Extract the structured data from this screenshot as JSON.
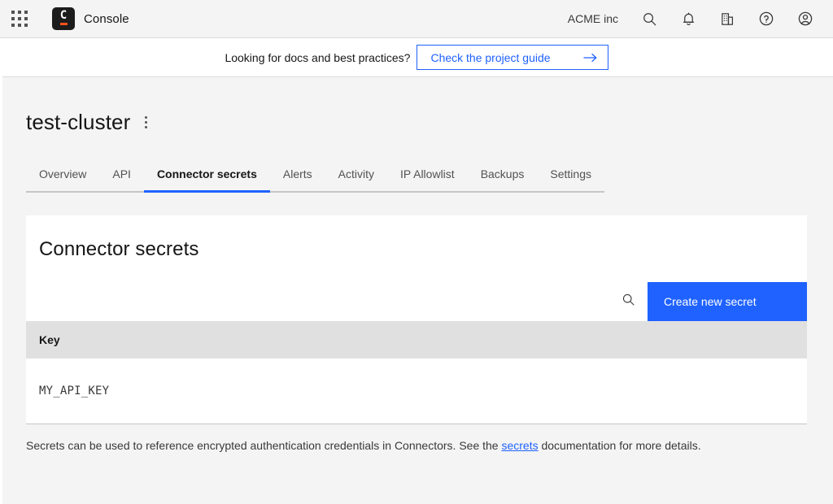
{
  "header": {
    "app_switcher_icon": "grid-apps-icon",
    "logo": {
      "letter": "C",
      "icon": "console-logo-icon"
    },
    "brand_name": "Console",
    "org_name": "ACME inc",
    "icons": [
      {
        "name": "search-icon"
      },
      {
        "name": "notifications-bell-icon"
      },
      {
        "name": "organization-building-icon"
      },
      {
        "name": "help-circle-icon"
      },
      {
        "name": "user-account-icon"
      }
    ]
  },
  "banner": {
    "text": "Looking for docs and best practices?",
    "cta_label": "Check the project guide",
    "cta_arrow_icon": "arrow-right-icon"
  },
  "page": {
    "title": "test-cluster",
    "overflow_menu_icon": "kebab-menu-icon"
  },
  "tabs": [
    {
      "label": "Overview",
      "active": false
    },
    {
      "label": "API",
      "active": false
    },
    {
      "label": "Connector secrets",
      "active": true
    },
    {
      "label": "Alerts",
      "active": false
    },
    {
      "label": "Activity",
      "active": false
    },
    {
      "label": "IP Allowlist",
      "active": false
    },
    {
      "label": "Backups",
      "active": false
    },
    {
      "label": "Settings",
      "active": false
    }
  ],
  "card": {
    "heading": "Connector secrets",
    "search_icon": "search-icon",
    "create_button_label": "Create new secret",
    "table": {
      "columns": [
        "Key"
      ],
      "rows": [
        {
          "key": "MY_API_KEY",
          "menu_icon": "kebab-menu-icon"
        }
      ]
    }
  },
  "footnote": {
    "text_before": "Secrets can be used to reference encrypted authentication credentials in Connectors. See the ",
    "link_label": "secrets",
    "text_after": " documentation for more details."
  },
  "colors": {
    "accent_blue": "#1f62ff",
    "page_background": "#f4f4f4",
    "card_background": "#ffffff",
    "table_header": "#e0e0e0",
    "logo_orange": "#f4511e"
  }
}
